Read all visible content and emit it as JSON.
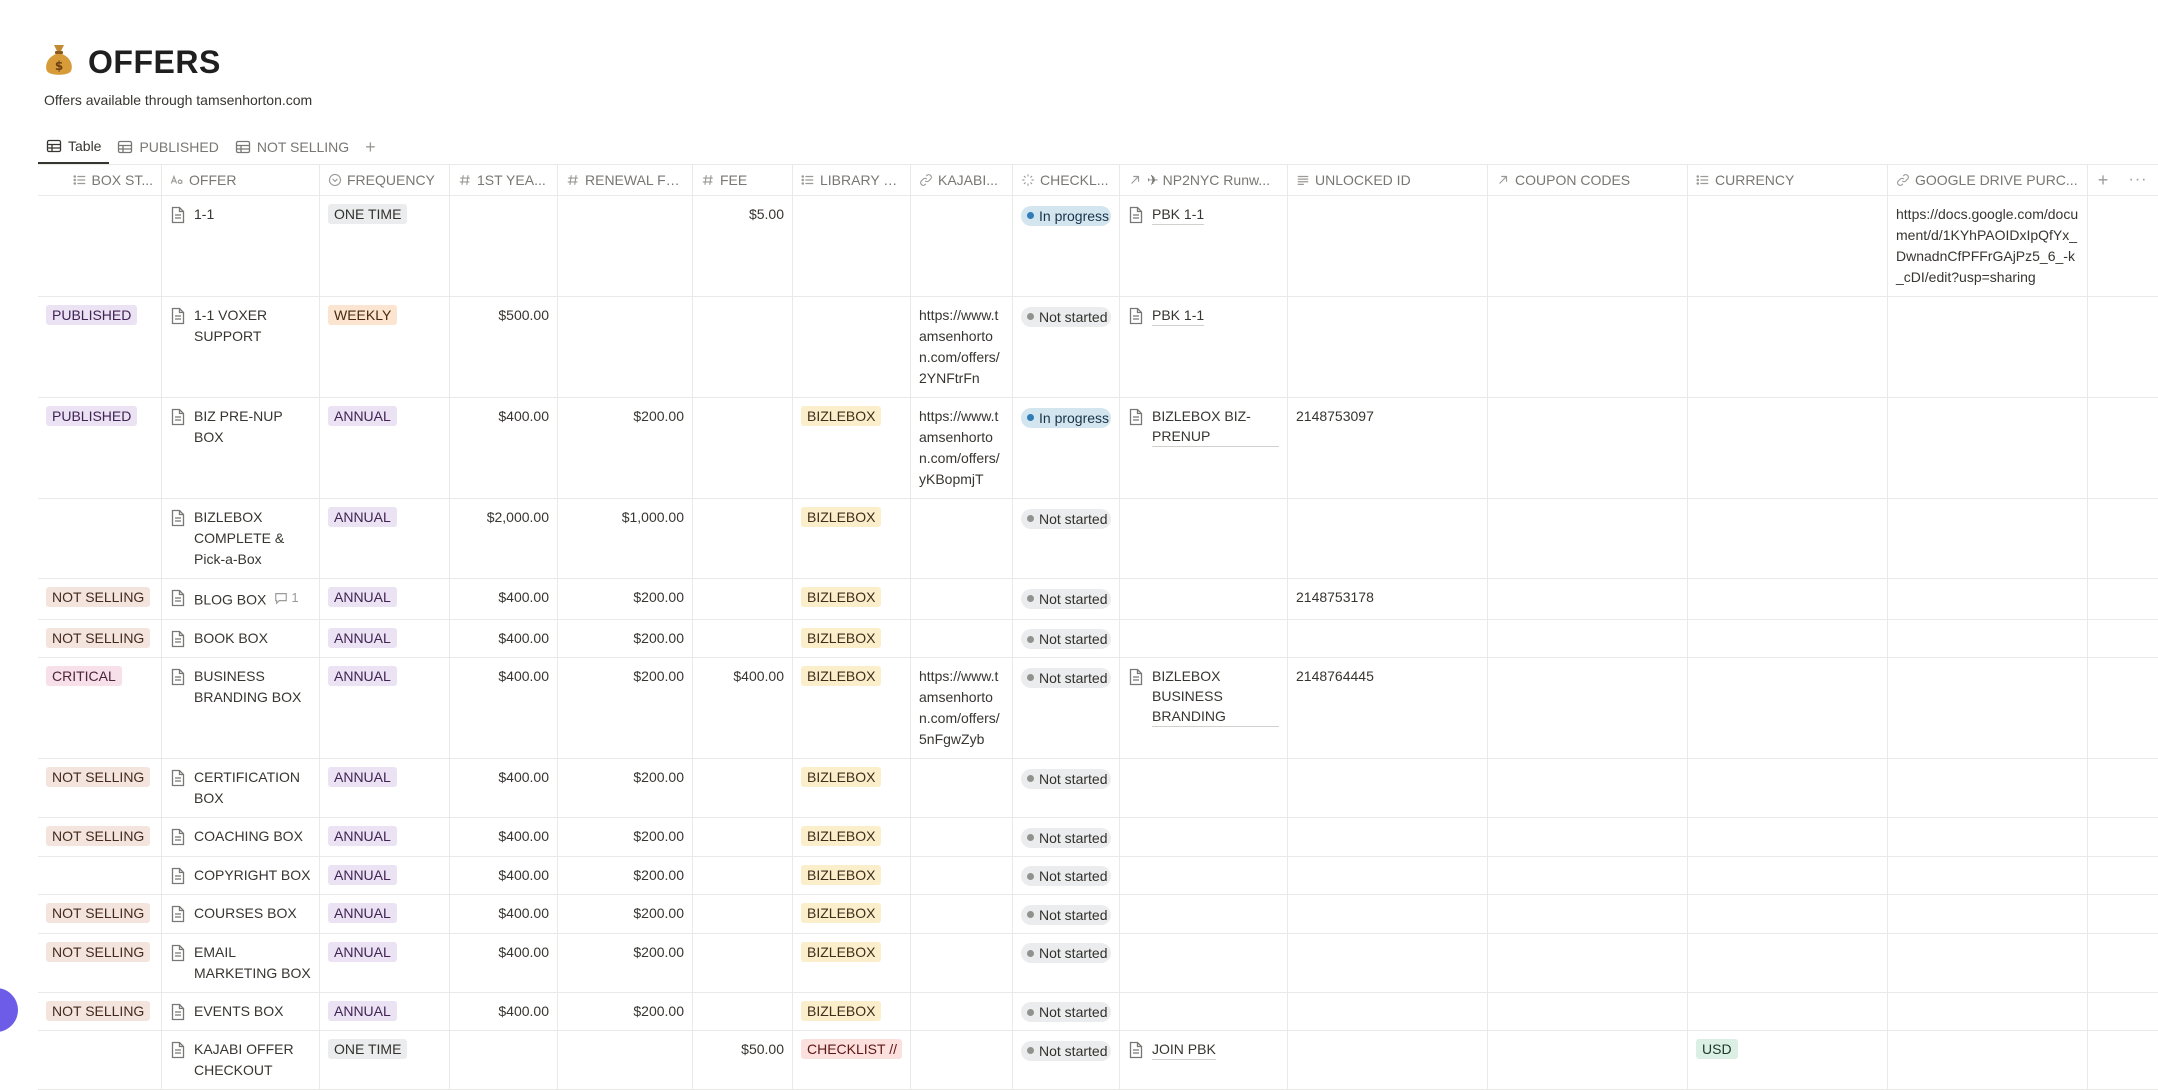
{
  "page": {
    "icon": "money-bag-icon",
    "title": "OFFERS",
    "subtitle": "Offers available through tamsenhorton.com"
  },
  "tabs": [
    {
      "label": "Table",
      "icon": "table-icon",
      "active": true
    },
    {
      "label": "PUBLISHED",
      "icon": "table-icon",
      "active": false
    },
    {
      "label": "NOT SELLING",
      "icon": "table-icon",
      "active": false
    }
  ],
  "columns": [
    {
      "key": "box_status",
      "label": "BOX ST...",
      "icon": "list-icon"
    },
    {
      "key": "offer",
      "label": "OFFER",
      "icon": "text-icon"
    },
    {
      "key": "frequency",
      "label": "FREQUENCY",
      "icon": "select-icon"
    },
    {
      "key": "first_year",
      "label": "1ST YEA...",
      "icon": "number-icon"
    },
    {
      "key": "renewal_fee",
      "label": "RENEWAL FEE",
      "icon": "number-icon"
    },
    {
      "key": "fee",
      "label": "FEE",
      "icon": "number-icon"
    },
    {
      "key": "library",
      "label": "LIBRARY P...",
      "icon": "list-icon"
    },
    {
      "key": "kajabi",
      "label": "KAJABI...",
      "icon": "link-icon"
    },
    {
      "key": "checklist",
      "label": "CHECKL...",
      "icon": "status-icon"
    },
    {
      "key": "np2nyc",
      "label": "✈ NP2NYC Runw...",
      "icon": "relation-icon"
    },
    {
      "key": "unlocked_id",
      "label": "UNLOCKED ID",
      "icon": "lines-icon"
    },
    {
      "key": "coupon_codes",
      "label": "COUPON CODES",
      "icon": "relation-icon"
    },
    {
      "key": "currency",
      "label": "CURRENCY",
      "icon": "list-icon"
    },
    {
      "key": "gdrive",
      "label": "GOOGLE DRIVE PURC...",
      "icon": "link-icon"
    }
  ],
  "header_extras": {
    "add": "+",
    "more": "···"
  },
  "rows": [
    {
      "box_status": "",
      "box_status_color": "",
      "offer": "1-1",
      "comments": "",
      "frequency": "ONE TIME",
      "frequency_color": "gray",
      "first_year": "",
      "renewal_fee": "",
      "fee": "$5.00",
      "library": "",
      "library_color": "",
      "kajabi": "",
      "checklist": "In progress",
      "checklist_state": "progress",
      "np2nyc": "PBK 1-1",
      "unlocked_id": "",
      "coupon_codes": "",
      "currency": "",
      "gdrive": "https://docs.google.com/document/d/1KYhPAOIDxIpQfYx_DwnadnCfPFFrGAjPz5_6_-k_cDI/edit?usp=sharing"
    },
    {
      "box_status": "PUBLISHED",
      "box_status_color": "purple",
      "offer": "1-1 VOXER SUPPORT",
      "comments": "",
      "frequency": "WEEKLY",
      "frequency_color": "orange",
      "first_year": "$500.00",
      "renewal_fee": "",
      "fee": "",
      "library": "",
      "library_color": "",
      "kajabi": "https://www.tamsenhorton.com/offers/2YNFtrFn",
      "checklist": "Not started",
      "checklist_state": "not",
      "np2nyc": "PBK 1-1",
      "unlocked_id": "",
      "coupon_codes": "",
      "currency": "",
      "gdrive": ""
    },
    {
      "box_status": "PUBLISHED",
      "box_status_color": "purple",
      "offer": "BIZ PRE-NUP BOX",
      "comments": "",
      "frequency": "ANNUAL",
      "frequency_color": "purple",
      "first_year": "$400.00",
      "renewal_fee": "$200.00",
      "fee": "",
      "library": "BIZLEBOX",
      "library_color": "yellow",
      "kajabi": "https://www.tamsenhorton.com/offers/yKBopmjT",
      "checklist": "In progress",
      "checklist_state": "progress",
      "np2nyc": "BIZLEBOX BIZ-PRENUP",
      "unlocked_id": "2148753097",
      "coupon_codes": "",
      "currency": "",
      "gdrive": ""
    },
    {
      "box_status": "",
      "box_status_color": "",
      "offer": "BIZLEBOX COMPLETE & Pick-a-Box",
      "comments": "",
      "frequency": "ANNUAL",
      "frequency_color": "purple",
      "first_year": "$2,000.00",
      "renewal_fee": "$1,000.00",
      "fee": "",
      "library": "BIZLEBOX",
      "library_color": "yellow",
      "kajabi": "",
      "checklist": "Not started",
      "checklist_state": "not",
      "np2nyc": "",
      "unlocked_id": "",
      "coupon_codes": "",
      "currency": "",
      "gdrive": ""
    },
    {
      "box_status": "NOT SELLING",
      "box_status_color": "brown",
      "offer": "BLOG BOX",
      "comments": "1",
      "frequency": "ANNUAL",
      "frequency_color": "purple",
      "first_year": "$400.00",
      "renewal_fee": "$200.00",
      "fee": "",
      "library": "BIZLEBOX",
      "library_color": "yellow",
      "kajabi": "",
      "checklist": "Not started",
      "checklist_state": "not",
      "np2nyc": "",
      "unlocked_id": "2148753178",
      "coupon_codes": "",
      "currency": "",
      "gdrive": ""
    },
    {
      "box_status": "NOT SELLING",
      "box_status_color": "brown",
      "offer": "BOOK BOX",
      "comments": "",
      "frequency": "ANNUAL",
      "frequency_color": "purple",
      "first_year": "$400.00",
      "renewal_fee": "$200.00",
      "fee": "",
      "library": "BIZLEBOX",
      "library_color": "yellow",
      "kajabi": "",
      "checklist": "Not started",
      "checklist_state": "not",
      "np2nyc": "",
      "unlocked_id": "",
      "coupon_codes": "",
      "currency": "",
      "gdrive": ""
    },
    {
      "box_status": "CRITICAL",
      "box_status_color": "pink",
      "offer": "BUSINESS BRANDING BOX",
      "comments": "",
      "frequency": "ANNUAL",
      "frequency_color": "purple",
      "first_year": "$400.00",
      "renewal_fee": "$200.00",
      "fee": "$400.00",
      "library": "BIZLEBOX",
      "library_color": "yellow",
      "kajabi": "https://www.tamsenhorton.com/offers/5nFgwZyb",
      "checklist": "Not started",
      "checklist_state": "not",
      "np2nyc": "BIZLEBOX BUSINESS BRANDING",
      "unlocked_id": "2148764445",
      "coupon_codes": "",
      "currency": "",
      "gdrive": ""
    },
    {
      "box_status": "NOT SELLING",
      "box_status_color": "brown",
      "offer": "CERTIFICATION BOX",
      "comments": "",
      "frequency": "ANNUAL",
      "frequency_color": "purple",
      "first_year": "$400.00",
      "renewal_fee": "$200.00",
      "fee": "",
      "library": "BIZLEBOX",
      "library_color": "yellow",
      "kajabi": "",
      "checklist": "Not started",
      "checklist_state": "not",
      "np2nyc": "",
      "unlocked_id": "",
      "coupon_codes": "",
      "currency": "",
      "gdrive": ""
    },
    {
      "box_status": "NOT SELLING",
      "box_status_color": "brown",
      "offer": "COACHING BOX",
      "comments": "",
      "frequency": "ANNUAL",
      "frequency_color": "purple",
      "first_year": "$400.00",
      "renewal_fee": "$200.00",
      "fee": "",
      "library": "BIZLEBOX",
      "library_color": "yellow",
      "kajabi": "",
      "checklist": "Not started",
      "checklist_state": "not",
      "np2nyc": "",
      "unlocked_id": "",
      "coupon_codes": "",
      "currency": "",
      "gdrive": ""
    },
    {
      "box_status": "",
      "box_status_color": "",
      "offer": "COPYRIGHT BOX",
      "comments": "",
      "frequency": "ANNUAL",
      "frequency_color": "purple",
      "first_year": "$400.00",
      "renewal_fee": "$200.00",
      "fee": "",
      "library": "BIZLEBOX",
      "library_color": "yellow",
      "kajabi": "",
      "checklist": "Not started",
      "checklist_state": "not",
      "np2nyc": "",
      "unlocked_id": "",
      "coupon_codes": "",
      "currency": "",
      "gdrive": ""
    },
    {
      "box_status": "NOT SELLING",
      "box_status_color": "brown",
      "offer": "COURSES BOX",
      "comments": "",
      "frequency": "ANNUAL",
      "frequency_color": "purple",
      "first_year": "$400.00",
      "renewal_fee": "$200.00",
      "fee": "",
      "library": "BIZLEBOX",
      "library_color": "yellow",
      "kajabi": "",
      "checklist": "Not started",
      "checklist_state": "not",
      "np2nyc": "",
      "unlocked_id": "",
      "coupon_codes": "",
      "currency": "",
      "gdrive": ""
    },
    {
      "box_status": "NOT SELLING",
      "box_status_color": "brown",
      "offer": "EMAIL MARKETING BOX",
      "comments": "",
      "frequency": "ANNUAL",
      "frequency_color": "purple",
      "first_year": "$400.00",
      "renewal_fee": "$200.00",
      "fee": "",
      "library": "BIZLEBOX",
      "library_color": "yellow",
      "kajabi": "",
      "checklist": "Not started",
      "checklist_state": "not",
      "np2nyc": "",
      "unlocked_id": "",
      "coupon_codes": "",
      "currency": "",
      "gdrive": ""
    },
    {
      "box_status": "NOT SELLING",
      "box_status_color": "brown",
      "offer": "EVENTS BOX",
      "comments": "",
      "frequency": "ANNUAL",
      "frequency_color": "purple",
      "first_year": "$400.00",
      "renewal_fee": "$200.00",
      "fee": "",
      "library": "BIZLEBOX",
      "library_color": "yellow",
      "kajabi": "",
      "checklist": "Not started",
      "checklist_state": "not",
      "np2nyc": "",
      "unlocked_id": "",
      "coupon_codes": "",
      "currency": "",
      "gdrive": ""
    },
    {
      "box_status": "",
      "box_status_color": "",
      "offer": "KAJABI OFFER CHECKOUT",
      "comments": "",
      "frequency": "ONE TIME",
      "frequency_color": "gray",
      "first_year": "",
      "renewal_fee": "",
      "fee": "$50.00",
      "library": "CHECKLIST //",
      "library_color": "red",
      "kajabi": "",
      "checklist": "Not started",
      "checklist_state": "not",
      "np2nyc": "JOIN PBK",
      "unlocked_id": "",
      "coupon_codes": "",
      "currency": "USD",
      "currency_color": "green",
      "gdrive": ""
    }
  ]
}
